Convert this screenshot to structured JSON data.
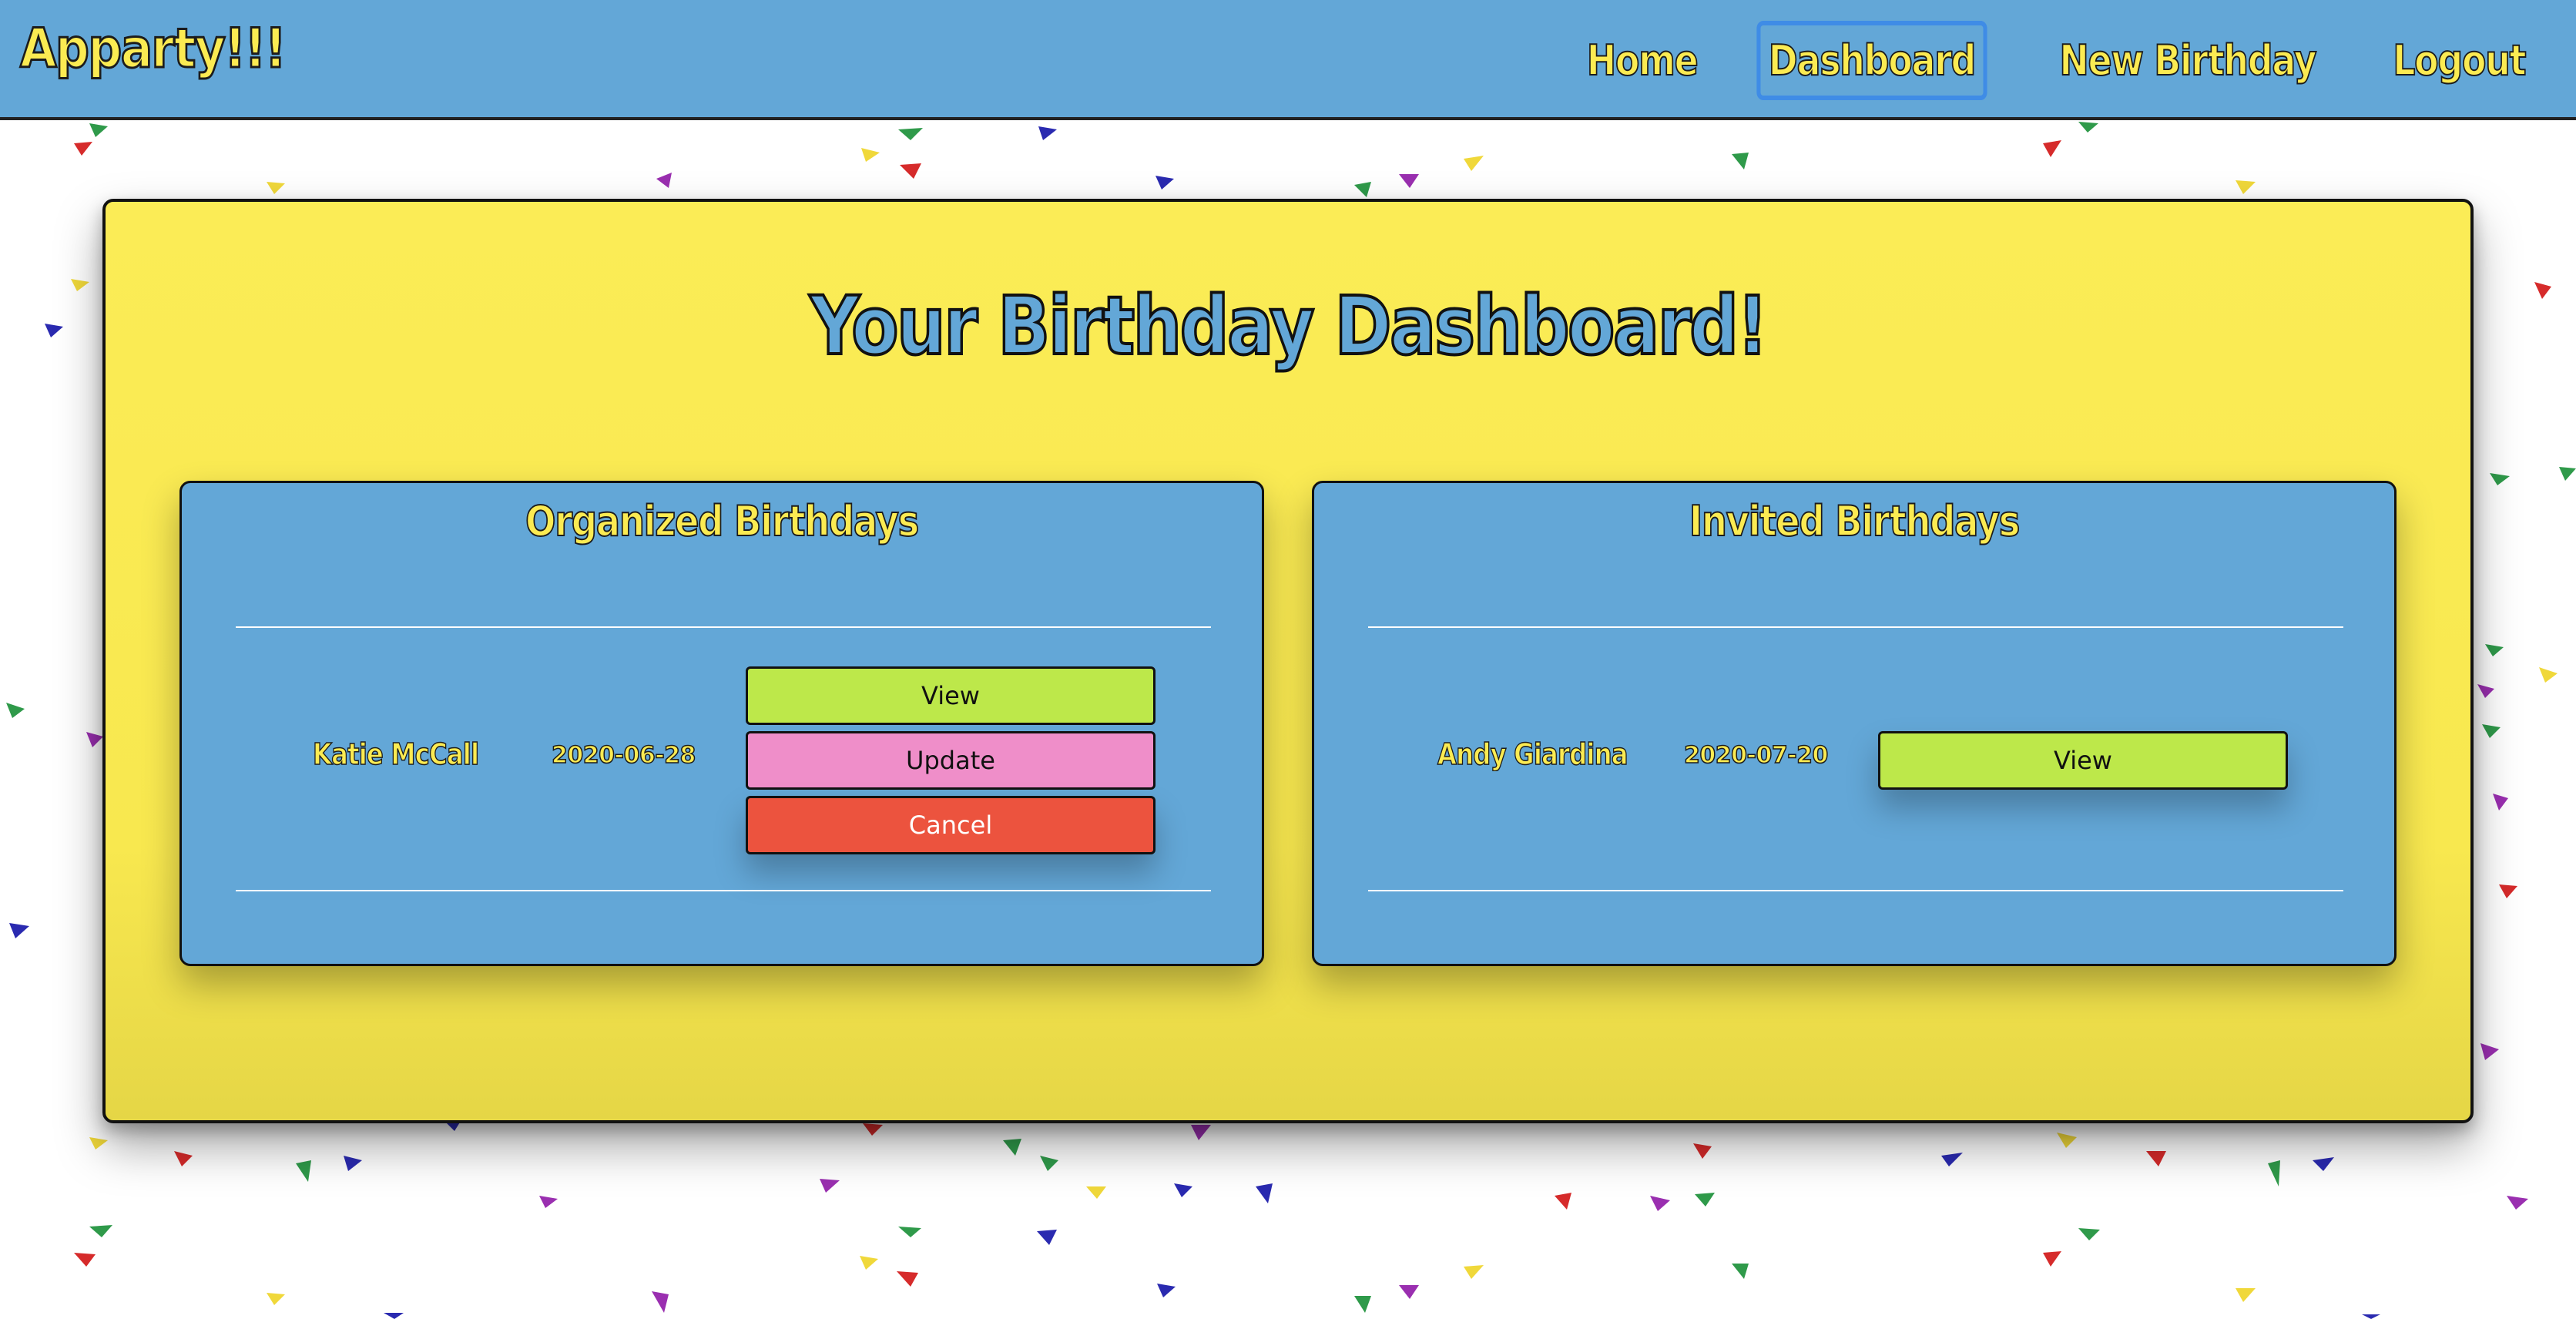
{
  "navbar": {
    "brand": "Apparty!!!",
    "links": {
      "home": "Home",
      "dashboard": "Dashboard",
      "new_birthday": "New Birthday",
      "logout": "Logout"
    },
    "active": "dashboard"
  },
  "dashboard": {
    "title": "Your Birthday Dashboard!"
  },
  "organized": {
    "title": "Organized Birthdays",
    "rows": [
      {
        "name": "Katie McCall",
        "date": "2020-06-28",
        "view_label": "View",
        "update_label": "Update",
        "cancel_label": "Cancel"
      }
    ]
  },
  "invited": {
    "title": "Invited Birthdays",
    "rows": [
      {
        "name": "Andy Giardina",
        "date": "2020-07-20",
        "view_label": "View"
      }
    ]
  },
  "colors": {
    "navbar_bg": "#63a7d7",
    "brand_yellow": "#fbeb52",
    "panel_yellow": "#fbec56",
    "card_blue": "#63a7d7",
    "view_green": "#bde84a",
    "update_pink": "#ef8ec9",
    "cancel_red": "#ec533e",
    "active_outline": "#3f8ce6"
  },
  "background": {
    "pattern": "confetti-triangles",
    "confetti_colors": [
      "#d62b2b",
      "#2f9a4a",
      "#2a2ab0",
      "#f0d83a",
      "#9a2fb0"
    ]
  }
}
